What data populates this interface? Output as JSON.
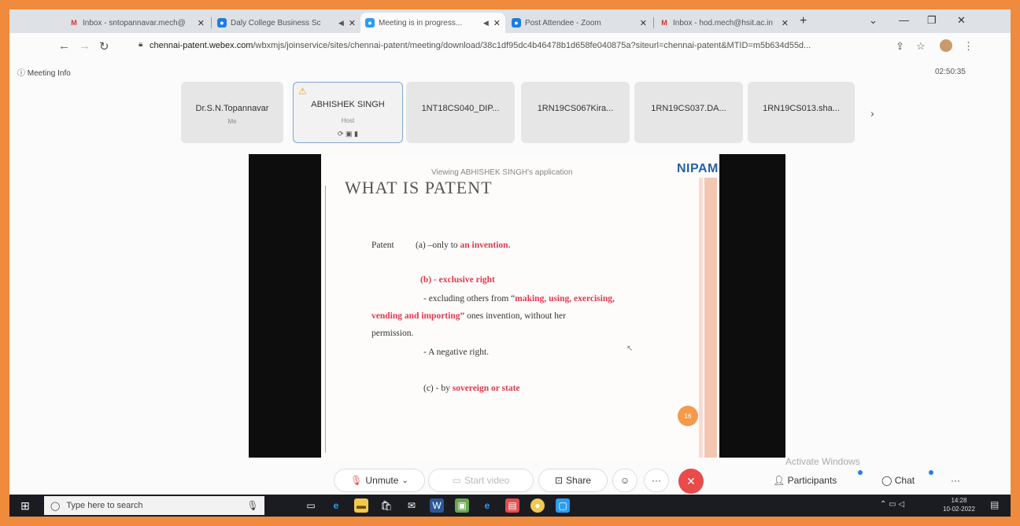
{
  "browser": {
    "tabs": [
      {
        "title": "Inbox - sntopannavar.mech@",
        "icon": "gmail-icon"
      },
      {
        "title": "Daly College Business Sc",
        "icon": "webex-icon"
      },
      {
        "title": "Meeting is in progress...",
        "icon": "webex-icon"
      },
      {
        "title": "Post Attendee - Zoom",
        "icon": "webex-icon"
      },
      {
        "title": "Inbox - hod.mech@hsit.ac.in",
        "icon": "gmail-icon"
      }
    ],
    "url_host": "chennai-patent.webex.com",
    "url_path": "/wbxmjs/joinservice/sites/chennai-patent/meeting/download/38c1df95dc4b46478b1d658fe040875a?siteurl=chennai-patent&MTID=m5b634d55d..."
  },
  "meeting": {
    "info_label": "Meeting Info",
    "timer": "02:50:35",
    "participants": [
      {
        "name": "Dr.S.N.Topannavar",
        "role": "Me"
      },
      {
        "name": "ABHISHEK SINGH",
        "role": "Host"
      },
      {
        "name": "1NT18CS040_DIP...",
        "role": ""
      },
      {
        "name": "1RN19CS067Kira...",
        "role": ""
      },
      {
        "name": "1RN19CS037.DA...",
        "role": ""
      },
      {
        "name": "1RN19CS013.sha...",
        "role": ""
      }
    ],
    "viewing_text": "Viewing ABHISHEK SINGH's application"
  },
  "slide": {
    "logo": "NIPAM",
    "title": "WHAT IS PATENT",
    "line1_a": "Patent",
    "line1_b": "(a) –only to ",
    "line1_red": "an invention.",
    "line2_red": "(b) - exclusive right",
    "line3_a": "- excluding others from “",
    "line3_red": "making, using, exercising,",
    "line4_red": "vending and importing”",
    "line4_b": " ones    invention, without her",
    "line5": "permission.",
    "line6": "- A negative right.",
    "line7_a": "(c) - by ",
    "line7_red": "sovereign or state",
    "page": "16"
  },
  "controls": {
    "unmute": "Unmute",
    "start_video": "Start video",
    "share": "Share",
    "participants": "Participants",
    "chat": "Chat"
  },
  "watermark": "Activate Windows",
  "taskbar": {
    "search_placeholder": "Type here to search",
    "time": "14:28",
    "date": "10-02-2022"
  }
}
